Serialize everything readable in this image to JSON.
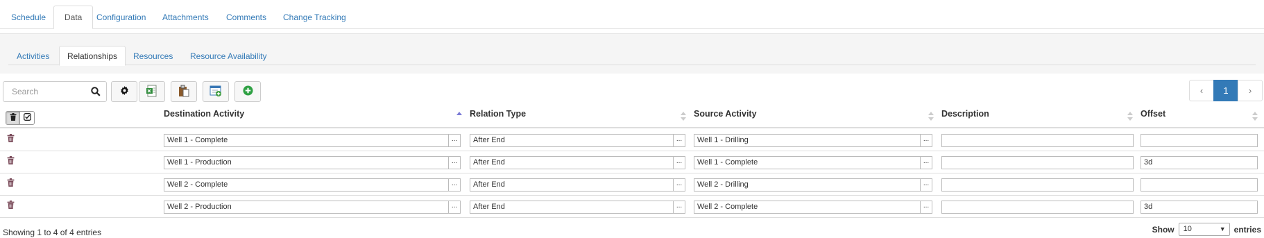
{
  "top_tabs": [
    {
      "label": "Schedule",
      "active": false
    },
    {
      "label": "Data",
      "active": true
    },
    {
      "label": "Configuration",
      "active": false
    },
    {
      "label": "Attachments",
      "active": false
    },
    {
      "label": "Comments",
      "active": false
    },
    {
      "label": "Change Tracking",
      "active": false
    }
  ],
  "sub_tabs": [
    {
      "label": "Activities",
      "active": false
    },
    {
      "label": "Relationships",
      "active": true
    },
    {
      "label": "Resources",
      "active": false
    },
    {
      "label": "Resource Availability",
      "active": false
    }
  ],
  "toolbar": {
    "search_placeholder": "Search",
    "buttons": [
      "gear-icon",
      "excel-export-icon",
      "paste-icon",
      "import-icon",
      "add-icon"
    ]
  },
  "pagination": {
    "prev": "‹",
    "current": "1",
    "next": "›"
  },
  "table": {
    "columns": [
      "Destination Activity",
      "Relation Type",
      "Source Activity",
      "Description",
      "Offset"
    ],
    "sorted_column": "Destination Activity",
    "picker_label": "...",
    "rows": [
      {
        "destination": "Well 1 - Complete",
        "relation": "After End",
        "source": "Well 1 - Drilling",
        "description": "",
        "offset": ""
      },
      {
        "destination": "Well 1 - Production",
        "relation": "After End",
        "source": "Well 1 - Complete",
        "description": "",
        "offset": "3d"
      },
      {
        "destination": "Well 2 - Complete",
        "relation": "After End",
        "source": "Well 2 - Drilling",
        "description": "",
        "offset": ""
      },
      {
        "destination": "Well 2 - Production",
        "relation": "After End",
        "source": "Well 2 - Complete",
        "description": "",
        "offset": "3d"
      }
    ]
  },
  "footer": {
    "info": "Showing 1 to 4 of 4 entries",
    "show_label": "Show",
    "page_length": "10",
    "entries_label": "entries"
  },
  "colors": {
    "link": "#337ab7",
    "page_active": "#337ab7",
    "delete_icon": "#7a4b5a",
    "add_icon": "#2ea043"
  }
}
